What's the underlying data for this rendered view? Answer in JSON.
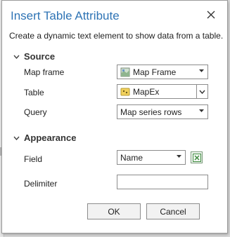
{
  "dialog": {
    "title": "Insert Table Attribute",
    "description": "Create a dynamic text element to show data from a table."
  },
  "source": {
    "heading": "Source",
    "map_frame": {
      "label": "Map frame",
      "value": "Map Frame"
    },
    "table": {
      "label": "Table",
      "value": "MapEx"
    },
    "query": {
      "label": "Query",
      "value": "Map series rows"
    }
  },
  "appearance": {
    "heading": "Appearance",
    "field": {
      "label": "Field",
      "value": "Name"
    },
    "delimiter": {
      "label": "Delimiter",
      "value": ""
    }
  },
  "buttons": {
    "ok": "OK",
    "cancel": "Cancel"
  },
  "colors": {
    "title": "#2f74b5",
    "table_icon": "#f2d15c",
    "field_icon": "#3d8a3d"
  },
  "icons": {
    "close": "close-icon",
    "map_frame": "map-frame-icon",
    "table": "table-icon",
    "field_picker": "field-picker-icon"
  }
}
